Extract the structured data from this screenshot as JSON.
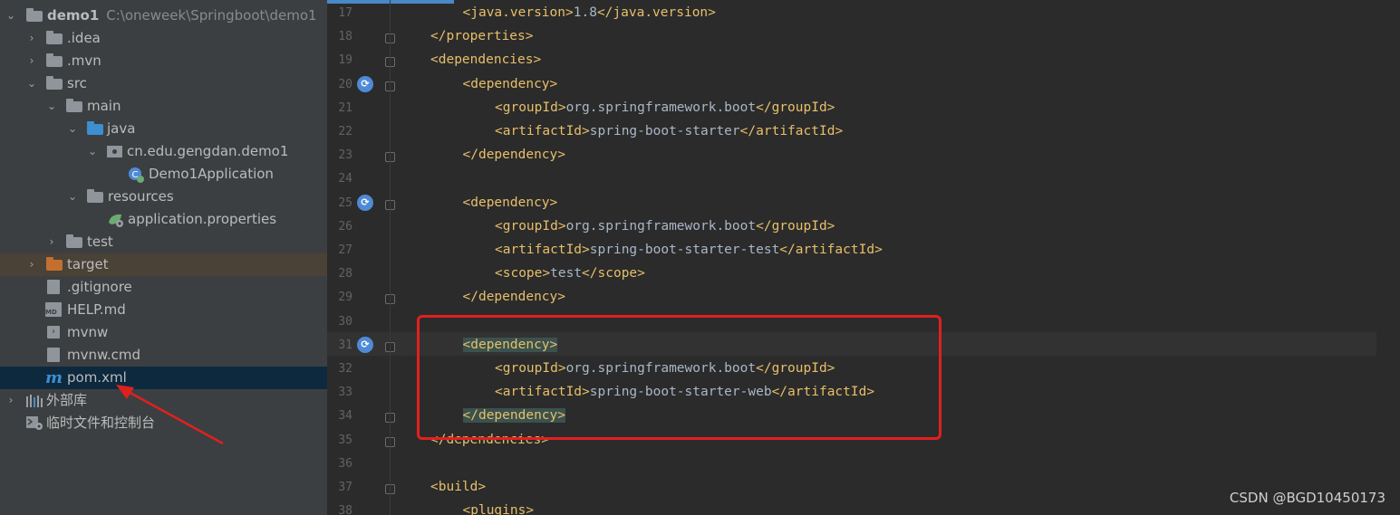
{
  "project_tree": {
    "root": {
      "name": "demo1",
      "path": "C:\\oneweek\\Springboot\\demo1"
    },
    "items": [
      {
        "label": ".idea"
      },
      {
        "label": ".mvn"
      },
      {
        "label": "src"
      },
      {
        "label": "main"
      },
      {
        "label": "java"
      },
      {
        "label": "cn.edu.gengdan.demo1"
      },
      {
        "label": "Demo1Application"
      },
      {
        "label": "resources"
      },
      {
        "label": "application.properties"
      },
      {
        "label": "test"
      },
      {
        "label": "target"
      },
      {
        "label": ".gitignore"
      },
      {
        "label": "HELP.md"
      },
      {
        "label": "mvnw"
      },
      {
        "label": "mvnw.cmd"
      },
      {
        "label": "pom.xml"
      },
      {
        "label": "外部库"
      },
      {
        "label": "临时文件和控制台"
      }
    ]
  },
  "editor": {
    "lines": [
      {
        "n": "17",
        "indent": 2,
        "open": "java.version",
        "text": "1.8",
        "close": "java.version"
      },
      {
        "n": "18",
        "indent": 1,
        "closeonly": "properties"
      },
      {
        "n": "19",
        "indent": 1,
        "openonly": "dependencies"
      },
      {
        "n": "20",
        "indent": 2,
        "openonly": "dependency"
      },
      {
        "n": "21",
        "indent": 3,
        "open": "groupId",
        "text": "org.springframework.boot",
        "close": "groupId"
      },
      {
        "n": "22",
        "indent": 3,
        "open": "artifactId",
        "text": "spring-boot-starter",
        "close": "artifactId"
      },
      {
        "n": "23",
        "indent": 2,
        "closeonly": "dependency"
      },
      {
        "n": "24"
      },
      {
        "n": "25",
        "indent": 2,
        "openonly": "dependency"
      },
      {
        "n": "26",
        "indent": 3,
        "open": "groupId",
        "text": "org.springframework.boot",
        "close": "groupId"
      },
      {
        "n": "27",
        "indent": 3,
        "open": "artifactId",
        "text": "spring-boot-starter-test",
        "close": "artifactId"
      },
      {
        "n": "28",
        "indent": 3,
        "open": "scope",
        "text": "test",
        "close": "scope"
      },
      {
        "n": "29",
        "indent": 2,
        "closeonly": "dependency"
      },
      {
        "n": "30"
      },
      {
        "n": "31",
        "indent": 2,
        "openonly": "dependency"
      },
      {
        "n": "32",
        "indent": 3,
        "open": "groupId",
        "text": "org.springframework.boot",
        "close": "groupId"
      },
      {
        "n": "33",
        "indent": 3,
        "open": "artifactId",
        "text": "spring-boot-starter-web",
        "close": "artifactId"
      },
      {
        "n": "34",
        "indent": 2,
        "closeonly": "dependency"
      },
      {
        "n": "35",
        "indent": 1,
        "closeonly": "dependencies"
      },
      {
        "n": "36"
      },
      {
        "n": "37",
        "indent": 1,
        "openonly": "build"
      },
      {
        "n": "38",
        "indent": 2,
        "openonly": "plugins"
      }
    ]
  },
  "watermark": "CSDN @BGD10450173",
  "colors": {
    "highlight_box": "#e0201f",
    "arrow": "#e0201f",
    "tag": "#e8bf6a"
  }
}
